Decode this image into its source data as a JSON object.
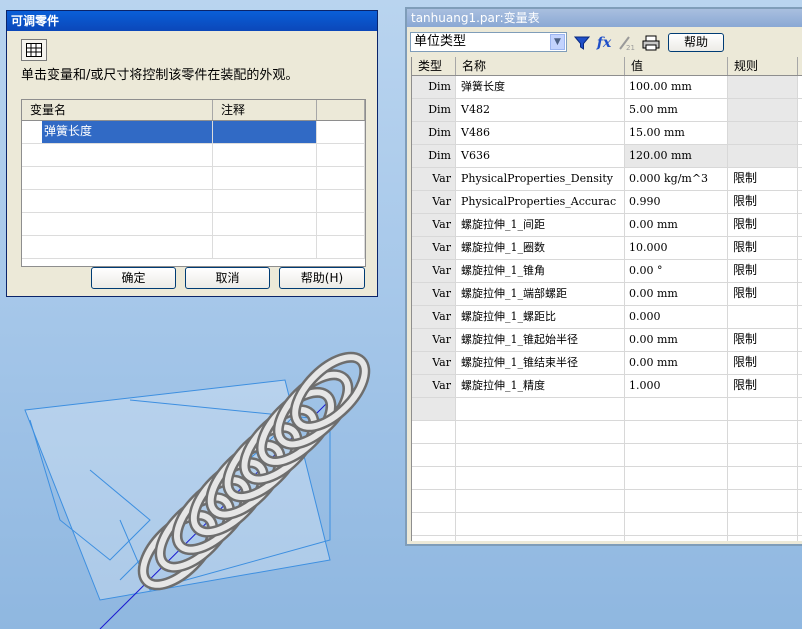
{
  "dialog": {
    "title": "可调零件",
    "description": "单击变量和/或尺寸将控制该零件在装配的外观。",
    "columns": [
      "变量名",
      "注释"
    ],
    "rows": [
      {
        "name": "弹簧长度",
        "note": ""
      }
    ],
    "ok": "确定",
    "cancel": "取消",
    "help": "帮助(H)"
  },
  "table_window": {
    "title": "tanhuang1.par:变量表",
    "filter": "单位类型",
    "help": "帮助",
    "columns": [
      "类型",
      "名称",
      "值",
      "规则"
    ],
    "rows": [
      {
        "type": "Dim",
        "name": "弹簧长度",
        "value": "100.00 mm",
        "rule": ""
      },
      {
        "type": "Dim",
        "name": "V482",
        "value": "5.00 mm",
        "rule": ""
      },
      {
        "type": "Dim",
        "name": "V486",
        "value": "15.00 mm",
        "rule": ""
      },
      {
        "type": "Dim",
        "name": "V636",
        "value": "120.00 mm",
        "rule": ""
      },
      {
        "type": "Var",
        "name": "PhysicalProperties_Density",
        "value": "0.000 kg/m^3",
        "rule": "限制"
      },
      {
        "type": "Var",
        "name": "PhysicalProperties_Accurac",
        "value": "0.990",
        "rule": "限制"
      },
      {
        "type": "Var",
        "name": "螺旋拉伸_1_间距",
        "value": "0.00 mm",
        "rule": "限制"
      },
      {
        "type": "Var",
        "name": "螺旋拉伸_1_圈数",
        "value": "10.000",
        "rule": "限制"
      },
      {
        "type": "Var",
        "name": "螺旋拉伸_1_锥角",
        "value": "0.00 °",
        "rule": "限制"
      },
      {
        "type": "Var",
        "name": "螺旋拉伸_1_端部螺距",
        "value": "0.00 mm",
        "rule": "限制"
      },
      {
        "type": "Var",
        "name": "螺旋拉伸_1_螺距比",
        "value": "0.000",
        "rule": ""
      },
      {
        "type": "Var",
        "name": "螺旋拉伸_1_锥起始半径",
        "value": "0.00 mm",
        "rule": "限制"
      },
      {
        "type": "Var",
        "name": "螺旋拉伸_1_锥结束半径",
        "value": "0.00 mm",
        "rule": "限制"
      },
      {
        "type": "Var",
        "name": "螺旋拉伸_1_精度",
        "value": "1.000",
        "rule": "限制"
      }
    ]
  },
  "colors": {
    "selection": "#316ac5",
    "titlebar": "#0b47b9",
    "background": "#a7c8ea"
  }
}
